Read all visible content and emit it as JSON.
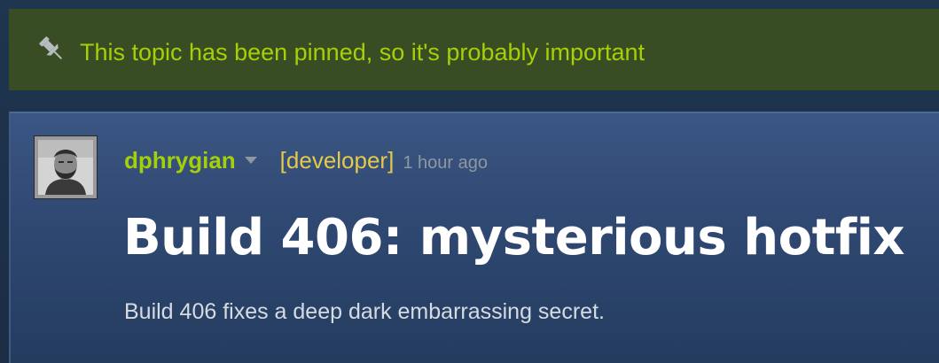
{
  "banner": {
    "icon": "pin-icon",
    "text": "This topic has been pinned, so it's probably important"
  },
  "post": {
    "author": {
      "name": "dphrygian",
      "avatar": "avatar",
      "role_badge": "[developer]",
      "menu_icon": "chevron-down-icon"
    },
    "timestamp": "1 hour ago",
    "title": "Build 406: mysterious hotfix",
    "body": "Build 406 fixes a deep dark embarrassing secret."
  },
  "colors": {
    "banner_bg": "#384d24",
    "banner_text": "#a4d007",
    "author_name": "#a4d007",
    "developer_badge": "#e5c94a",
    "timestamp": "#8f98a0",
    "title": "#ffffff",
    "body": "#d6dbe2"
  }
}
